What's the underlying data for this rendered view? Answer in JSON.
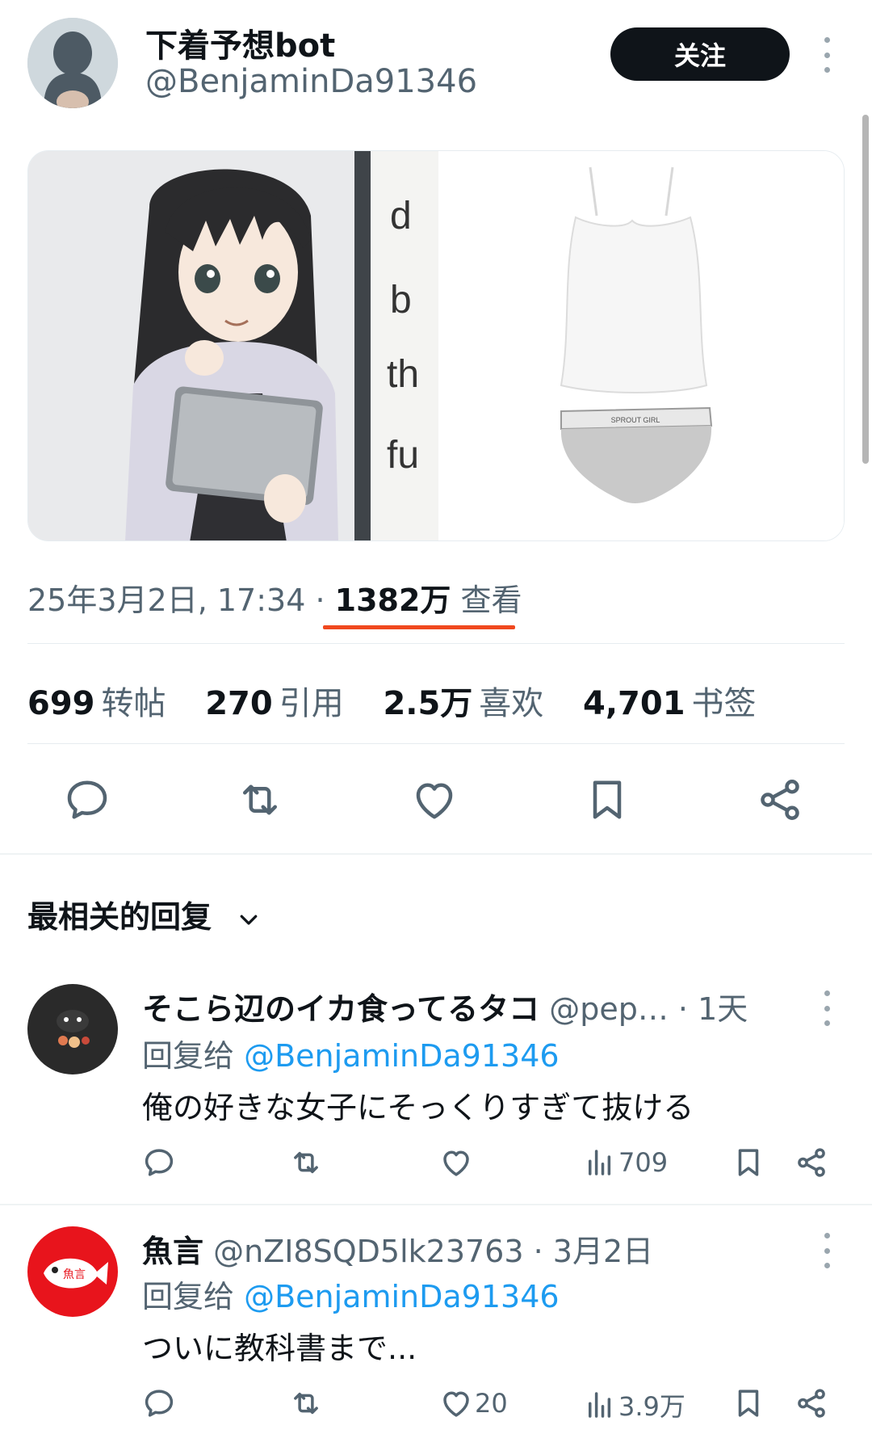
{
  "header": {
    "display_name": "下着予想bot",
    "handle": "@BenjaminDa91346",
    "follow_label": "关注"
  },
  "post": {
    "timestamp": "25年3月2日, 17:34 · ",
    "views_count": "1382万",
    "views_label": " 查看",
    "media_left_text": [
      "d",
      "b",
      "th",
      "fu"
    ],
    "media_right_brand": "SPROUT GIRL"
  },
  "stats": [
    {
      "count": "699",
      "label": "转帖"
    },
    {
      "count": "270",
      "label": "引用"
    },
    {
      "count": "2.5万",
      "label": "喜欢"
    },
    {
      "count": "4,701",
      "label": "书签"
    }
  ],
  "replies_section": {
    "sort_label": "最相关的回复"
  },
  "replies": [
    {
      "name": "そこら辺のイカ食ってるタコ",
      "handle": "@pep…",
      "time": "· 1天",
      "reply_prefix": "回复给 ",
      "reply_to": "@BenjaminDa91346",
      "text": "俺の好きな女子にそっくりすぎて抜ける",
      "likes": "",
      "views": "709"
    },
    {
      "name": "魚言",
      "handle": "@nZI8SQD5lk23763",
      "time": "· 3月2日",
      "reply_prefix": "回复给 ",
      "reply_to": "@BenjaminDa91346",
      "text": "ついに教科書まで...",
      "likes": "20",
      "views": "3.9万",
      "avatar_text": "魚言"
    }
  ],
  "colors": {
    "accent_link": "#1d9bf0",
    "underline": "#f0481e",
    "text_secondary": "#536471",
    "follow_bg": "#0f1419"
  }
}
